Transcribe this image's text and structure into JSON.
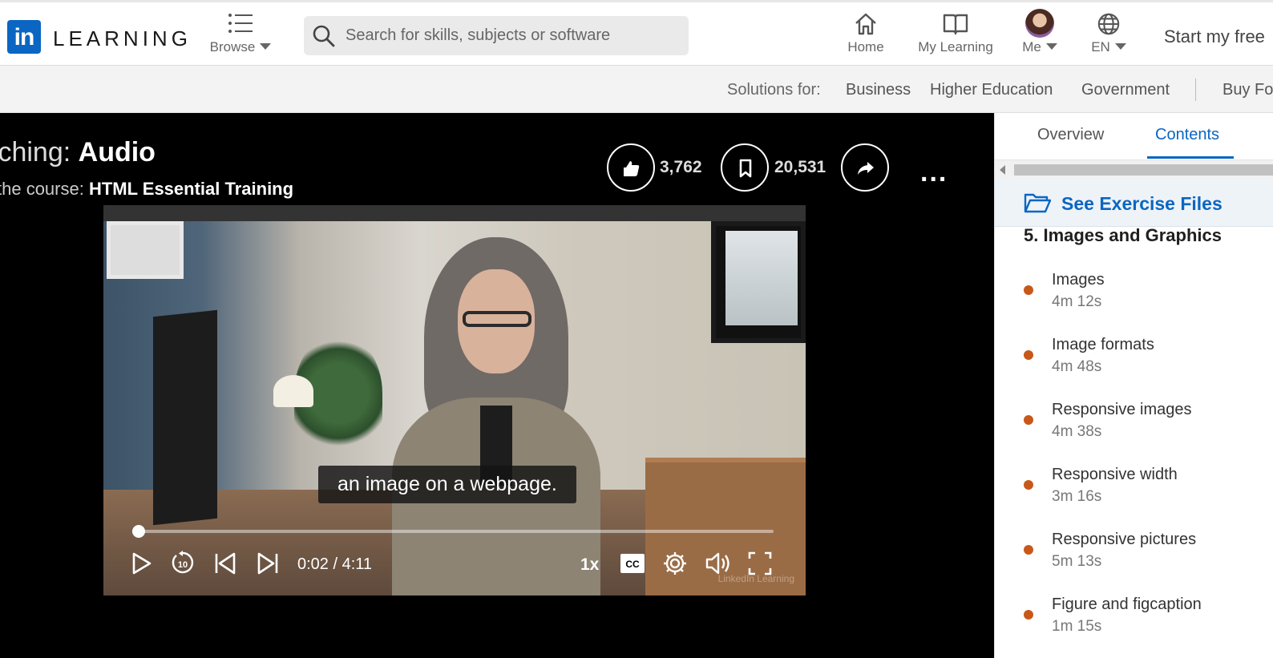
{
  "header": {
    "logo_mark": "in",
    "logo_word": "LEARNING",
    "browse_label": "Browse",
    "search_placeholder": "Search for skills, subjects or software",
    "nav": {
      "home": "Home",
      "my_learning": "My Learning",
      "me": "Me",
      "language": "EN"
    },
    "trial_button": "Start my free"
  },
  "solutions_bar": {
    "label": "Solutions for:",
    "items": [
      "Business",
      "Higher Education",
      "Government"
    ],
    "buy": "Buy Fo"
  },
  "player": {
    "watching_prefix": "tching:",
    "watching_title": "Audio",
    "course_prefix": "the course:",
    "course_title": "HTML Essential Training",
    "likes": "3,762",
    "saves": "20,531",
    "more": "...",
    "caption": "an image on a webpage.",
    "time": "0:02 / 4:11",
    "progress_fraction": 0.008,
    "speed": "1x",
    "cc": "CC",
    "watermark": "LinkedIn Learning"
  },
  "sidebar": {
    "tabs": [
      "Overview",
      "Contents"
    ],
    "active_tab": "Contents",
    "exercise_files": "See Exercise Files",
    "section_title": "5. Images and Graphics",
    "items": [
      {
        "title": "Images",
        "duration": "4m 12s"
      },
      {
        "title": "Image formats",
        "duration": "4m 48s"
      },
      {
        "title": "Responsive images",
        "duration": "4m 38s"
      },
      {
        "title": "Responsive width",
        "duration": "3m 16s"
      },
      {
        "title": "Responsive pictures",
        "duration": "5m 13s"
      },
      {
        "title": "Figure and figcaption",
        "duration": "1m 15s"
      }
    ]
  },
  "colors": {
    "brand_blue": "#0a66c2",
    "progress_dot": "#c8581a"
  }
}
